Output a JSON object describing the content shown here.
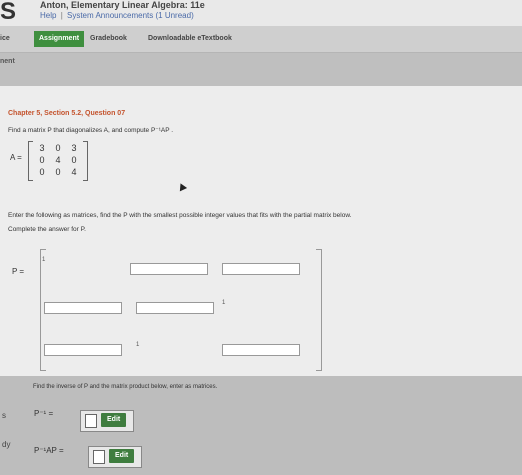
{
  "header": {
    "course_title": "Anton, Elementary Linear Algebra: 11e",
    "help_link": "Help",
    "separator": "|",
    "announcements_link": "System Announcements (1 Unread)",
    "logo_letter": "S"
  },
  "nav": {
    "partial_left": "ice",
    "tabs": [
      {
        "label": "Assignment",
        "active": true
      },
      {
        "label": "Gradebook",
        "active": false
      },
      {
        "label": "Downloadable eTextbook",
        "active": false
      }
    ]
  },
  "section_label": "nent",
  "question": {
    "title": "Chapter 5, Section 5.2, Question 07",
    "prompt": "Find a matrix P that diagonalizes A, and compute P⁻¹AP .",
    "matrix_label": "A =",
    "matrix_A": [
      [
        "3",
        "0",
        "3"
      ],
      [
        "0",
        "4",
        "0"
      ],
      [
        "0",
        "0",
        "4"
      ]
    ],
    "instruction": "Enter the following as matrices, find the P with the smallest possible integer values that fits with the partial matrix below.",
    "complete_text": "Complete the answer for P."
  },
  "matrix_P": {
    "label": "P =",
    "given": {
      "r0c0": "1",
      "r1c2": "1",
      "r2c1": "1"
    }
  },
  "inverse": {
    "text": "Find the inverse of P and the matrix product below, enter as matrices.",
    "p_inv_label": "P⁻¹ =",
    "product_label": "P⁻¹AP =",
    "edit_label": "Edit"
  },
  "side": {
    "label1": "s",
    "label2": "dy"
  },
  "colors": {
    "accent_green": "#3f8f3f",
    "question_title": "#c4532d",
    "link_blue": "#4a6aa8"
  }
}
